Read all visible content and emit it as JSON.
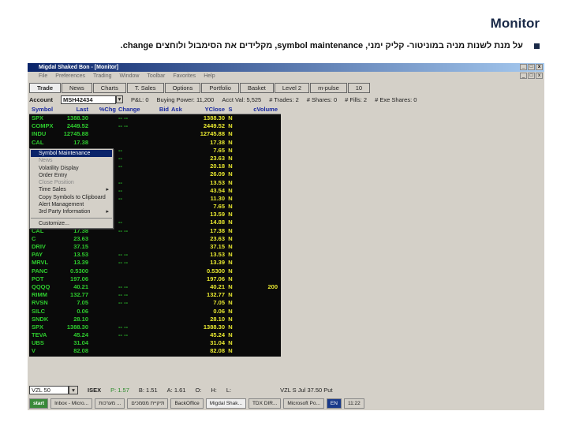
{
  "slide": {
    "title": "Monitor",
    "bullet": "על מנת לשנות מניה במוניטור- קליק ימני, symbol maintenance, מקלידים את הסימבול ולוחצים change."
  },
  "window": {
    "title": "Migdal Shaked Bon - [Monitor]",
    "menu": [
      "File",
      "Preferences",
      "Trading",
      "Window",
      "Toolbar",
      "Favorites",
      "Help"
    ],
    "tabs": [
      "Trade",
      "News",
      "Charts",
      "T. Sales",
      "Options",
      "Portfolio",
      "Basket",
      "Level 2",
      "m-pulse",
      "10"
    ],
    "account": {
      "label": "Account",
      "value": "MSH42434",
      "pnl": "P&L: 0",
      "buying_power": "Buying Power: 11,200",
      "acct_val": "Acct Val: 5,525",
      "trades": "# Trades: 2",
      "shares": "# Shares: 0",
      "fills": "# Fills: 2",
      "exec_shares": "# Exe Shares: 0"
    },
    "grid": {
      "columns": [
        "Symbol",
        "Last",
        "%Chg",
        "Change",
        "Bid",
        "Ask",
        "YClose",
        "S",
        "cVolume"
      ],
      "rows": [
        [
          "SPX",
          "1388.30",
          "",
          "-- --",
          "",
          "",
          "1388.30",
          "N",
          ""
        ],
        [
          "COMPX",
          "2449.52",
          "",
          "-- --",
          "",
          "",
          "2449.52",
          "N",
          ""
        ],
        [
          "INDU",
          "12745.88",
          "",
          "",
          "",
          "",
          "12745.88",
          "N",
          ""
        ],
        [
          "CAL",
          "17.38",
          "",
          "",
          "",
          "",
          "17.38",
          "N",
          ""
        ],
        [
          "",
          "",
          "",
          "--",
          "",
          "",
          "7.65",
          "N",
          ""
        ],
        [
          "",
          "",
          "",
          "--",
          "",
          "",
          "23.63",
          "N",
          ""
        ],
        [
          "",
          "",
          "",
          "--",
          "",
          "",
          "20.18",
          "N",
          ""
        ],
        [
          "",
          "",
          "",
          "",
          "",
          "",
          "26.09",
          "N",
          ""
        ],
        [
          "",
          "",
          "",
          "--",
          "",
          "",
          "13.53",
          "N",
          ""
        ],
        [
          "",
          "",
          "",
          "--",
          "",
          "",
          "43.54",
          "N",
          ""
        ],
        [
          "",
          "",
          "",
          "--",
          "",
          "",
          "11.30",
          "N",
          ""
        ],
        [
          "",
          "",
          "",
          "",
          "",
          "",
          "7.65",
          "N",
          ""
        ],
        [
          "",
          "",
          "",
          "",
          "",
          "",
          "13.59",
          "N",
          ""
        ],
        [
          "",
          "",
          "",
          "--",
          "",
          "",
          "14.88",
          "N",
          ""
        ],
        [
          "CAL",
          "17.38",
          "",
          "-- --",
          "",
          "",
          "17.38",
          "N",
          ""
        ],
        [
          "C",
          "23.63",
          "",
          "",
          "",
          "",
          "23.63",
          "N",
          ""
        ],
        [
          "DRIV",
          "37.15",
          "",
          "",
          "",
          "",
          "37.15",
          "N",
          ""
        ],
        [
          "PAY",
          "13.53",
          "",
          "-- --",
          "",
          "",
          "13.53",
          "N",
          ""
        ],
        [
          "MRVL",
          "13.39",
          "",
          "-- --",
          "",
          "",
          "13.39",
          "N",
          ""
        ],
        [
          "PANC",
          "0.5300",
          "",
          "",
          "",
          "",
          "0.5300",
          "N",
          ""
        ],
        [
          "POT",
          "197.06",
          "",
          "",
          "",
          "",
          "197.06",
          "N",
          ""
        ],
        [
          "QQQQ",
          "40.21",
          "",
          "-- --",
          "",
          "",
          "40.21",
          "N",
          "200"
        ],
        [
          "RIMM",
          "132.77",
          "",
          "-- --",
          "",
          "",
          "132.77",
          "N",
          ""
        ],
        [
          "RVSN",
          "7.05",
          "",
          "-- --",
          "",
          "",
          "7.05",
          "N",
          ""
        ],
        [
          "SILC",
          "0.06",
          "",
          "",
          "",
          "",
          "0.06",
          "N",
          ""
        ],
        [
          "SNDK",
          "28.10",
          "",
          "",
          "",
          "",
          "28.10",
          "N",
          ""
        ],
        [
          "SPX",
          "1388.30",
          "",
          "-- --",
          "",
          "",
          "1388.30",
          "N",
          ""
        ],
        [
          "TEVA",
          "45.24",
          "",
          "-- --",
          "",
          "",
          "45.24",
          "N",
          ""
        ],
        [
          "UBS",
          "31.04",
          "",
          "",
          "",
          "",
          "31.04",
          "N",
          ""
        ],
        [
          "V",
          "82.08",
          "",
          "",
          "",
          "",
          "82.08",
          "N",
          ""
        ]
      ]
    },
    "context_menu": [
      {
        "label": "Symbol Maintenance",
        "state": "highlighted"
      },
      {
        "label": "News",
        "state": "disabled"
      },
      {
        "label": "Volatility Display"
      },
      {
        "label": "Order Entry"
      },
      {
        "label": "Close Position",
        "state": "disabled"
      },
      {
        "label": "Time Sales",
        "submenu": true
      },
      {
        "label": "Copy Symbols to Clipboard"
      },
      {
        "label": "Alert Management"
      },
      {
        "label": "3rd Party Information",
        "submenu": true
      },
      {
        "label": "Customize..."
      }
    ],
    "bottom": {
      "symbol": "VZL 50",
      "exchange": "ISEX",
      "price": "P: 1.57",
      "bid": "B: 1.51",
      "ask": "A: 1.61",
      "open": "O:",
      "high": "H:",
      "low": "L:",
      "description": "VZL S Jul 37.50 Put"
    }
  },
  "taskbar": {
    "start": "start",
    "items": [
      "Inbox - Micro...",
      "מערכות ...",
      "תיקיית מסמכים",
      "BackOffice",
      "Migdal Shak...",
      "TDX DIR...",
      "Microsoft Po..."
    ],
    "lang": "EN",
    "clock": "11:22"
  }
}
